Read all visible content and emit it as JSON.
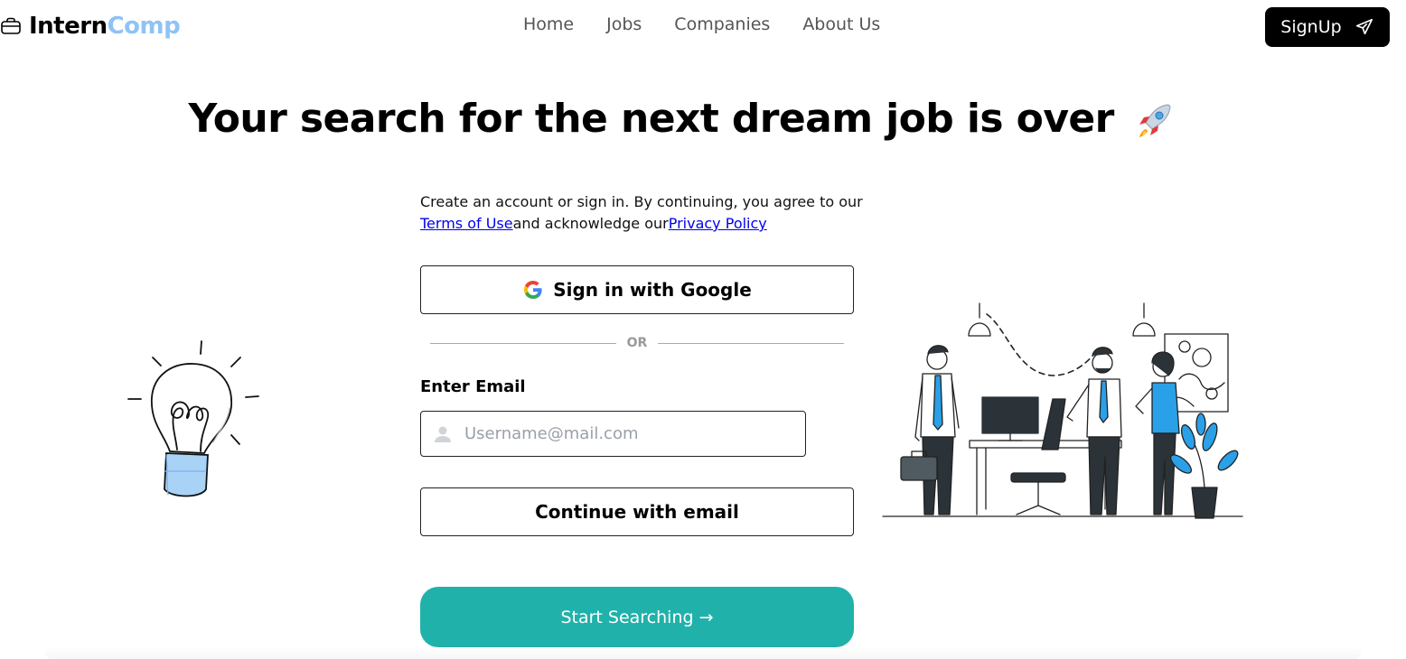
{
  "header": {
    "logo_part1": "Intern",
    "logo_part2": "Comp",
    "nav": [
      "Home",
      "Jobs",
      "Companies",
      "About Us"
    ],
    "signup_label": "SignUp"
  },
  "hero": {
    "title": "Your search for the next dream job is over"
  },
  "form": {
    "consent_text_1": "Create an account or sign in. By continuing, you agree to our",
    "terms_link": "Terms of Use",
    "consent_text_2": "and acknowledge our",
    "privacy_link": "Privacy Policy",
    "google_label": "Sign in with Google",
    "divider_text": "OR",
    "email_label": "Enter Email",
    "email_placeholder": "Username@mail.com",
    "email_value": "",
    "continue_label": "Continue with email",
    "start_label": "Start Searching →"
  },
  "colors": {
    "accent": "#20b2aa",
    "logo_blue": "#8ec3f5",
    "bulb_blue": "#a9d2f7",
    "illustration_blue": "#2aa0e8"
  },
  "icons": {
    "logo": "briefcase-icon",
    "signup": "paper-plane-icon",
    "google": "google-icon",
    "email_field": "user-icon",
    "hero": "rocket-icon"
  }
}
